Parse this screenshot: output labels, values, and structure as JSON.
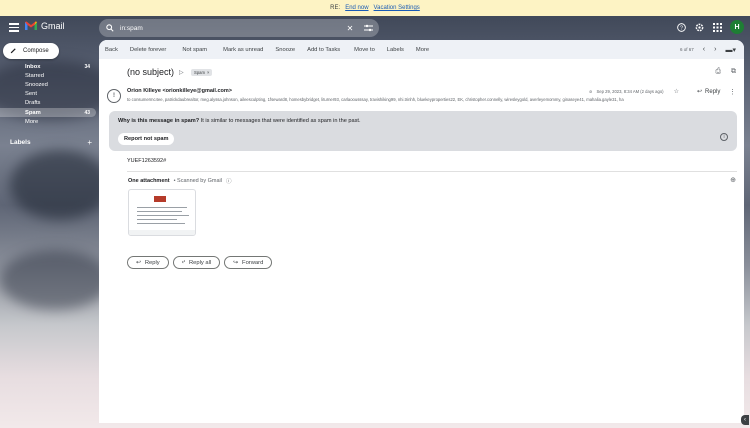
{
  "notice": {
    "prefix": "RE: ",
    "end_now": "End now",
    "settings": "Vacation Settings"
  },
  "header": {
    "app_name": "Gmail",
    "search_query": "in:spam",
    "avatar_letter": "H"
  },
  "nav": {
    "compose": "Compose",
    "items": [
      {
        "label": "Inbox",
        "count": "34"
      },
      {
        "label": "Starred",
        "count": ""
      },
      {
        "label": "Snoozed",
        "count": ""
      },
      {
        "label": "Sent",
        "count": ""
      },
      {
        "label": "Drafts",
        "count": ""
      },
      {
        "label": "Spam",
        "count": "43"
      },
      {
        "label": "More",
        "count": ""
      }
    ],
    "labels_header": "Labels"
  },
  "toolbar": {
    "back": "Back",
    "delete_forever": "Delete forever",
    "not_spam": "Not spam",
    "mark_unread": "Mark as unread",
    "snooze": "Snooze",
    "add_tasks": "Add to Tasks",
    "move_to": "Move to",
    "labels": "Labels",
    "more": "More",
    "pagination": "6 of 67"
  },
  "email": {
    "subject": "(no subject)",
    "tag": "Spam",
    "sender": "Orion Killeye <orionkilleye@gmail.com>",
    "to": "to consumermc4ee, patrickdaubrealtor, meg.alyssa.johnson, aileesculpting, 1fseward8, homesbybridget, liturner93, carlaoousssay, travishiking99, nhi.trinhh, bluekeyproperties22, EK, christopher.connelly, wiresleygold, averleyemommy, ginaseye41, mahalia.gayle31, ha",
    "date": "Sep 29, 2023, 8:34 AM (2 days ago)",
    "reply_top": "Reply",
    "spam_reason_bold": "Why is this message in spam?",
    "spam_reason_rest": " It is similar to messages that were identified as spam in the past.",
    "report_not_spam": "Report not spam",
    "body": "YUEF1263592#",
    "attachment_count": "One attachment",
    "scanned": "•  Scanned by Gmail",
    "reply": "Reply",
    "reply_all": "Reply all",
    "forward": "Forward"
  },
  "colors": {
    "accent": "#1a73e8",
    "notice_bg": "#fdf3c4",
    "avatar_bg": "#1e7e34"
  }
}
